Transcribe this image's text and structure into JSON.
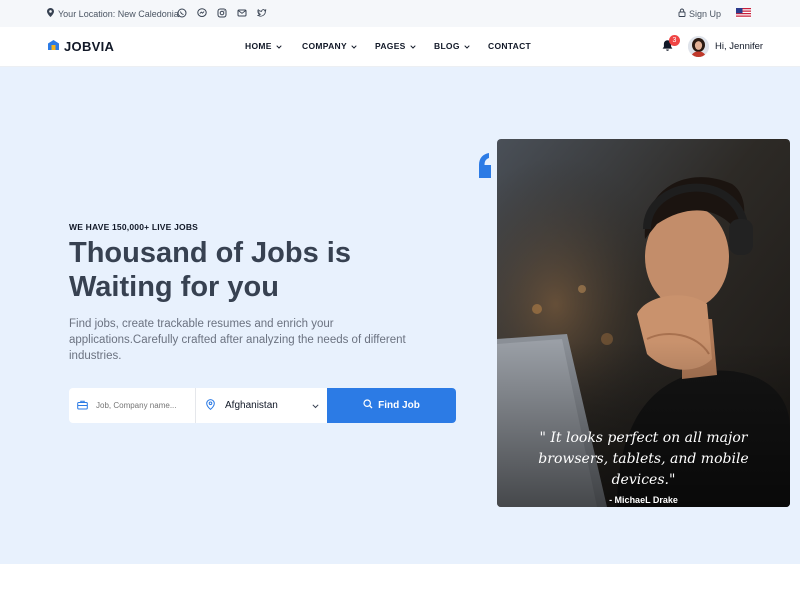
{
  "topbar": {
    "location": "Your Location: New Caledonia",
    "socials": [
      "whatsapp-icon",
      "messenger-icon",
      "instagram-icon",
      "envelope-icon",
      "twitter-icon"
    ],
    "signup": "Sign Up"
  },
  "brand": {
    "name": "JOBVIA"
  },
  "nav": [
    {
      "label": "HOME",
      "dropdown": true
    },
    {
      "label": "COMPANY",
      "dropdown": true
    },
    {
      "label": "PAGES",
      "dropdown": true
    },
    {
      "label": "BLOG",
      "dropdown": true
    },
    {
      "label": "CONTACT",
      "dropdown": false
    }
  ],
  "user": {
    "notifications": "3",
    "greeting": "Hi, Jennifer"
  },
  "hero": {
    "eyebrow": "WE HAVE 150,000+ LIVE JOBS",
    "headline": "Thousand of Jobs is Waiting for you",
    "description": "Find jobs, create trackable resumes and enrich your applications.Carefully crafted after analyzing the needs of different industries."
  },
  "search": {
    "placeholder": "Job, Company name...",
    "location": "Afghanistan",
    "button": "Find Job"
  },
  "testimonial": {
    "quote": "\" It looks perfect on all major browsers, tablets, and mobile devices.\"",
    "author": "- MichaeL Drake"
  },
  "colors": {
    "accent": "#2c7be5",
    "hero_bg": "#e8f1fd",
    "badge": "#ef4444"
  }
}
